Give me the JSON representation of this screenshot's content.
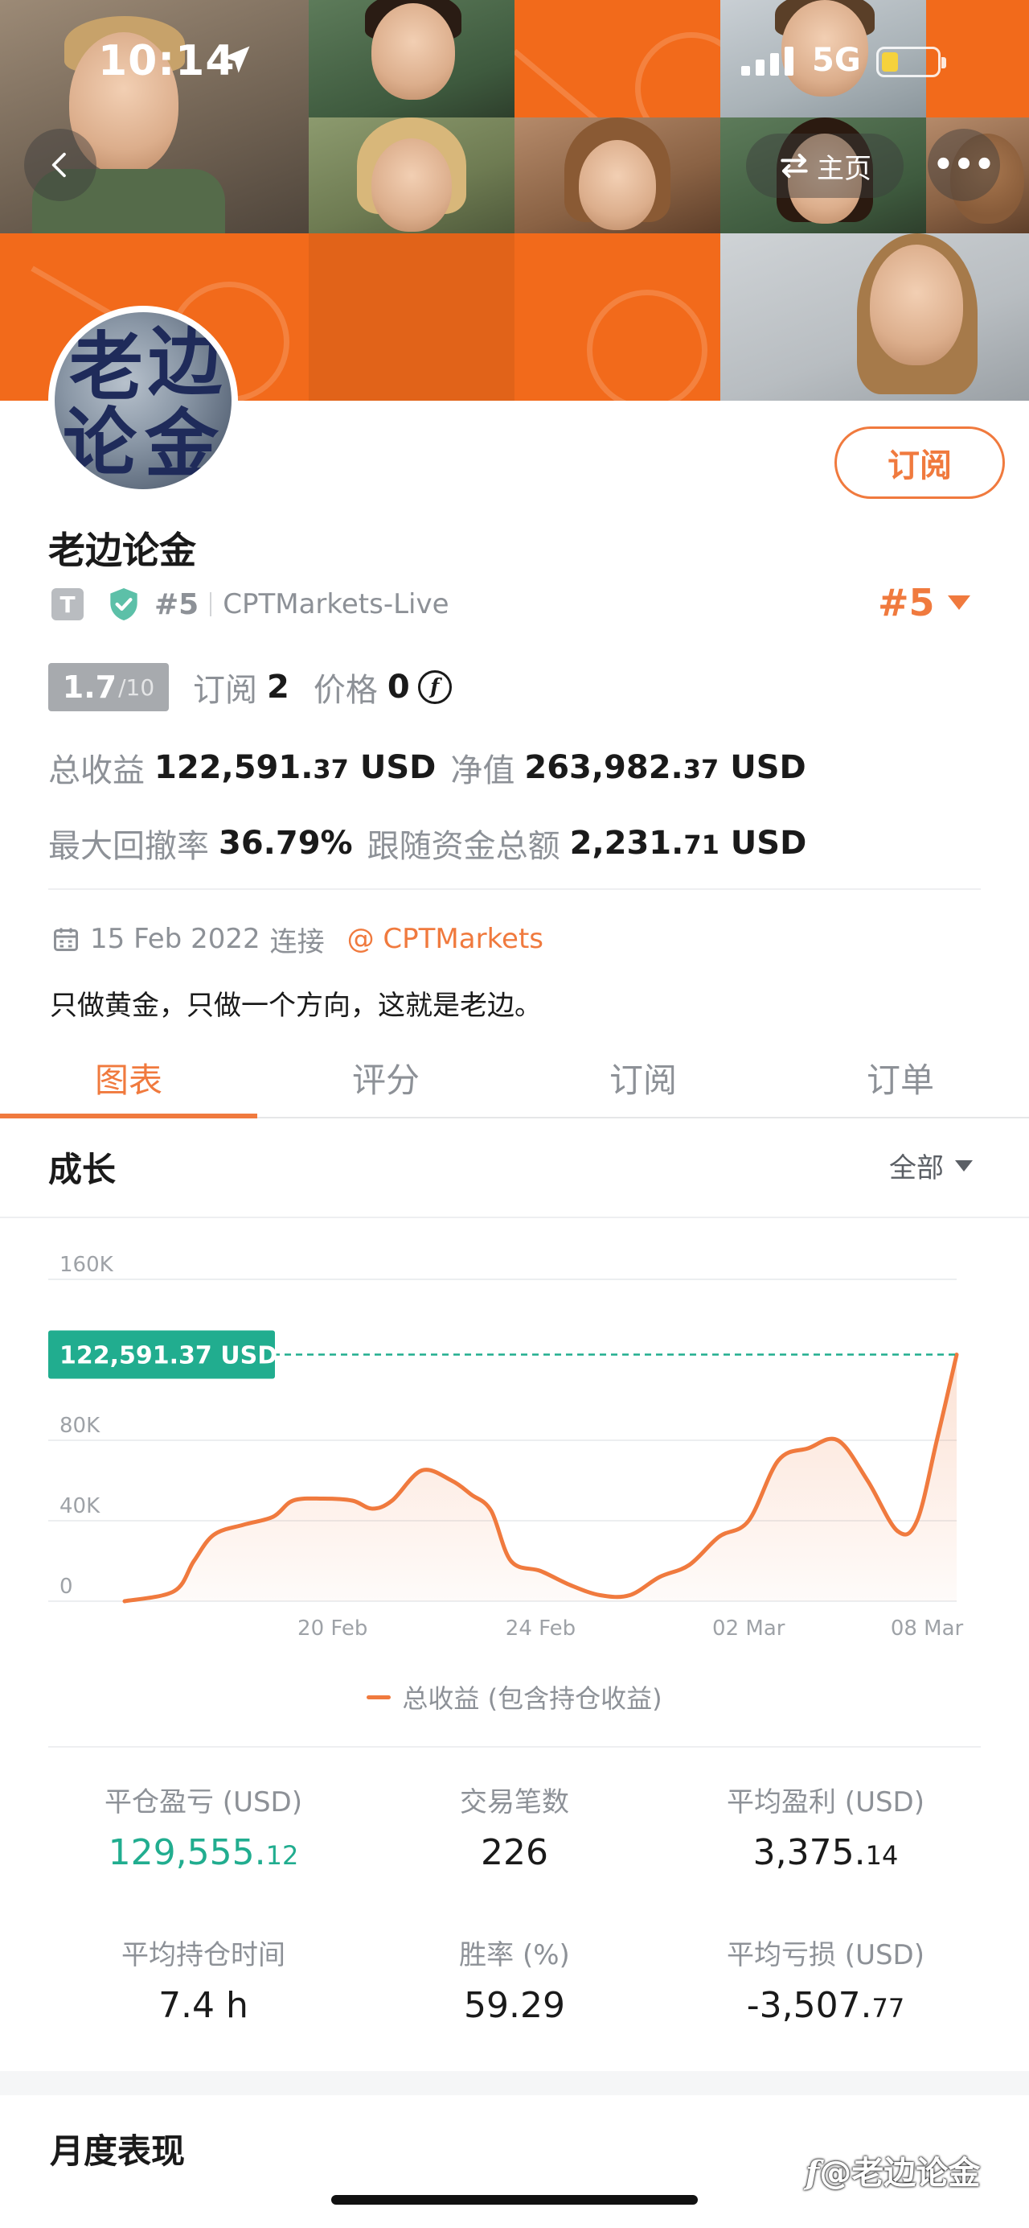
{
  "status_bar": {
    "time": "10:14",
    "network": "5G"
  },
  "header": {
    "home_label": "主页",
    "more_label": "•••",
    "avatar_chars": [
      "老",
      "边",
      "论",
      "金"
    ]
  },
  "profile": {
    "subscribe_label": "订阅",
    "name": "老边论金",
    "t_badge": "T",
    "rank": "#5",
    "broker": "CPTMarkets-Live",
    "rank_right": "#5",
    "score": "1.7",
    "score_denominator": "/10",
    "subscribe_count_label": "订阅",
    "subscribe_count": "2",
    "price_label": "价格",
    "price": "0",
    "price_coin": "f",
    "total_profit_label": "总收益",
    "total_profit_int": "122,591.",
    "total_profit_dec": "37",
    "total_profit_unit": "USD",
    "equity_label": "净值",
    "equity_int": "263,982.",
    "equity_dec": "37",
    "equity_unit": "USD",
    "max_drawdown_label": "最大回撤率",
    "max_drawdown": "36.79%",
    "follow_funds_label": "跟随资金总额",
    "follow_funds_int": "2,231.",
    "follow_funds_dec": "71",
    "follow_funds_unit": "USD",
    "joined_date": "15 Feb 2022",
    "joined_label": "连接",
    "broker_link": "@ CPTMarkets",
    "bio": "只做黄金，只做一个方向，这就是老边。"
  },
  "tabs": [
    {
      "label": "图表",
      "active": true
    },
    {
      "label": "评分",
      "active": false
    },
    {
      "label": "订阅",
      "active": false
    },
    {
      "label": "订单",
      "active": false
    }
  ],
  "growth": {
    "title": "成长",
    "filter_label": "全部"
  },
  "chart_data": {
    "type": "area",
    "series": [
      {
        "name": "总收益 (包含持仓收益)",
        "color": "#f07a3e",
        "x": [
          "15 Feb",
          "16 Feb",
          "17 Feb",
          "18 Feb",
          "19 Feb",
          "20 Feb",
          "21 Feb",
          "22 Feb",
          "23 Feb",
          "24 Feb",
          "25 Feb",
          "26 Feb",
          "27 Feb",
          "28 Feb",
          "01 Mar",
          "02 Mar",
          "03 Mar",
          "04 Mar",
          "05 Mar",
          "06 Mar",
          "07 Mar",
          "08 Mar"
        ],
        "values": [
          0,
          5000,
          33000,
          40000,
          50000,
          51000,
          46000,
          66000,
          50000,
          17000,
          10000,
          2000,
          16000,
          36000,
          72000,
          80000,
          35000,
          122591.37,
          null,
          null,
          null,
          null
        ]
      }
    ],
    "plot_points": [
      [
        0,
        0
      ],
      [
        1,
        5000
      ],
      [
        1.4,
        20000
      ],
      [
        1.8,
        33000
      ],
      [
        2.4,
        38000
      ],
      [
        3.0,
        42000
      ],
      [
        3.4,
        50000
      ],
      [
        4.0,
        51000
      ],
      [
        4.6,
        50000
      ],
      [
        5.0,
        46000
      ],
      [
        5.4,
        50000
      ],
      [
        6.0,
        65000
      ],
      [
        6.6,
        60000
      ],
      [
        7.0,
        53000
      ],
      [
        7.4,
        45000
      ],
      [
        7.8,
        20000
      ],
      [
        8.4,
        15000
      ],
      [
        9.0,
        8000
      ],
      [
        9.6,
        3000
      ],
      [
        10.2,
        3000
      ],
      [
        10.8,
        12000
      ],
      [
        11.4,
        18000
      ],
      [
        12.0,
        32000
      ],
      [
        12.6,
        40000
      ],
      [
        13.2,
        70000
      ],
      [
        13.8,
        76000
      ],
      [
        14.4,
        80000
      ],
      [
        15.0,
        60000
      ],
      [
        15.6,
        35000
      ],
      [
        16.0,
        40000
      ],
      [
        16.4,
        80000
      ],
      [
        16.8,
        122591.37
      ]
    ],
    "x_range": [
      0,
      16.8
    ],
    "y_range": [
      0,
      160000
    ],
    "y_ticks": [
      {
        "v": 0,
        "label": "0"
      },
      {
        "v": 40000,
        "label": "40K"
      },
      {
        "v": 80000,
        "label": "80K"
      },
      {
        "v": 160000,
        "label": "160K"
      }
    ],
    "x_ticks": [
      {
        "v": 4.2,
        "label": "20 Feb"
      },
      {
        "v": 8.4,
        "label": "24 Feb"
      },
      {
        "v": 12.6,
        "label": "02 Mar"
      },
      {
        "v": 16.2,
        "label": "08 Mar"
      }
    ],
    "reference_line": {
      "value": 122591.37,
      "label": "122,591.37 USD",
      "color": "#21ad8f"
    },
    "grid": true,
    "legend": "bottom"
  },
  "legend_label": "总收益 (包含持仓收益)",
  "metrics": [
    {
      "label": "平仓盈亏 (USD)",
      "int": "129,555.",
      "dec": "12",
      "green": true
    },
    {
      "label": "交易笔数",
      "int": "226",
      "dec": "",
      "green": false
    },
    {
      "label": "平均盈利 (USD)",
      "int": "3,375.",
      "dec": "14",
      "green": false
    },
    {
      "label": "平均持仓时间",
      "int": "7.4 h",
      "dec": "",
      "green": false
    },
    {
      "label": "胜率 (%)",
      "int": "59.29",
      "dec": "",
      "green": false
    },
    {
      "label": "平均亏损 (USD)",
      "int": "-3,507.",
      "dec": "77",
      "green": false
    }
  ],
  "monthly_title": "月度表现",
  "watermark": "@老边论金",
  "watermark_icon": "f"
}
